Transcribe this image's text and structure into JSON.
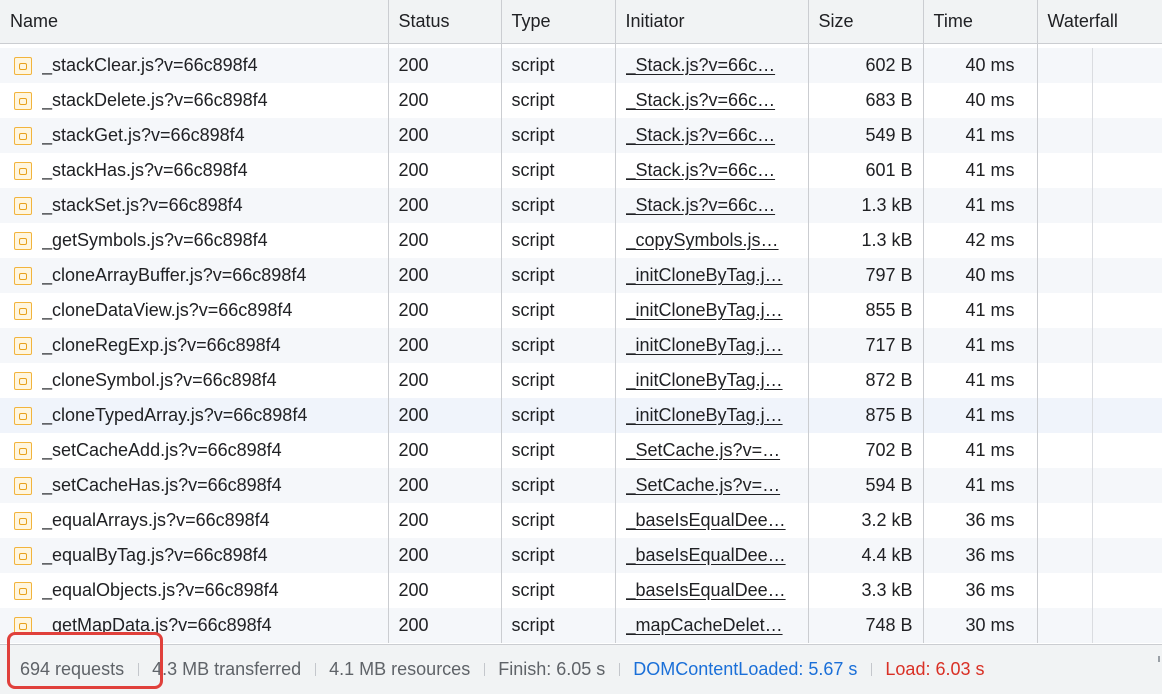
{
  "headers": {
    "name": "Name",
    "status": "Status",
    "type": "Type",
    "initiator": "Initiator",
    "size": "Size",
    "time": "Time",
    "waterfall": "Waterfall"
  },
  "rows": [
    {
      "name": "_stackClear.js?v=66c898f4",
      "status": "200",
      "type": "script",
      "initiator": "_Stack.js?v=66c…",
      "size": "602 B",
      "time": "40 ms"
    },
    {
      "name": "_stackDelete.js?v=66c898f4",
      "status": "200",
      "type": "script",
      "initiator": "_Stack.js?v=66c…",
      "size": "683 B",
      "time": "40 ms"
    },
    {
      "name": "_stackGet.js?v=66c898f4",
      "status": "200",
      "type": "script",
      "initiator": "_Stack.js?v=66c…",
      "size": "549 B",
      "time": "41 ms"
    },
    {
      "name": "_stackHas.js?v=66c898f4",
      "status": "200",
      "type": "script",
      "initiator": "_Stack.js?v=66c…",
      "size": "601 B",
      "time": "41 ms"
    },
    {
      "name": "_stackSet.js?v=66c898f4",
      "status": "200",
      "type": "script",
      "initiator": "_Stack.js?v=66c…",
      "size": "1.3 kB",
      "time": "41 ms"
    },
    {
      "name": "_getSymbols.js?v=66c898f4",
      "status": "200",
      "type": "script",
      "initiator": "_copySymbols.js…",
      "size": "1.3 kB",
      "time": "42 ms"
    },
    {
      "name": "_cloneArrayBuffer.js?v=66c898f4",
      "status": "200",
      "type": "script",
      "initiator": "_initCloneByTag.j…",
      "size": "797 B",
      "time": "40 ms"
    },
    {
      "name": "_cloneDataView.js?v=66c898f4",
      "status": "200",
      "type": "script",
      "initiator": "_initCloneByTag.j…",
      "size": "855 B",
      "time": "41 ms"
    },
    {
      "name": "_cloneRegExp.js?v=66c898f4",
      "status": "200",
      "type": "script",
      "initiator": "_initCloneByTag.j…",
      "size": "717 B",
      "time": "41 ms"
    },
    {
      "name": "_cloneSymbol.js?v=66c898f4",
      "status": "200",
      "type": "script",
      "initiator": "_initCloneByTag.j…",
      "size": "872 B",
      "time": "41 ms"
    },
    {
      "name": "_cloneTypedArray.js?v=66c898f4",
      "status": "200",
      "type": "script",
      "initiator": "_initCloneByTag.j…",
      "size": "875 B",
      "time": "41 ms"
    },
    {
      "name": "_setCacheAdd.js?v=66c898f4",
      "status": "200",
      "type": "script",
      "initiator": "_SetCache.js?v=…",
      "size": "702 B",
      "time": "41 ms"
    },
    {
      "name": "_setCacheHas.js?v=66c898f4",
      "status": "200",
      "type": "script",
      "initiator": "_SetCache.js?v=…",
      "size": "594 B",
      "time": "41 ms"
    },
    {
      "name": "_equalArrays.js?v=66c898f4",
      "status": "200",
      "type": "script",
      "initiator": "_baseIsEqualDee…",
      "size": "3.2 kB",
      "time": "36 ms"
    },
    {
      "name": "_equalByTag.js?v=66c898f4",
      "status": "200",
      "type": "script",
      "initiator": "_baseIsEqualDee…",
      "size": "4.4 kB",
      "time": "36 ms"
    },
    {
      "name": "_equalObjects.js?v=66c898f4",
      "status": "200",
      "type": "script",
      "initiator": "_baseIsEqualDee…",
      "size": "3.3 kB",
      "time": "36 ms"
    },
    {
      "name": "_getMapData.js?v=66c898f4",
      "status": "200",
      "type": "script",
      "initiator": "_mapCacheDelet…",
      "size": "748 B",
      "time": "30 ms"
    }
  ],
  "status_bar": {
    "requests": "694 requests",
    "transferred": "4.3 MB transferred",
    "resources": "4.1 MB resources",
    "finish": "Finish: 6.05 s",
    "dom_content_loaded": "DOMContentLoaded: 5.67 s",
    "load": "Load: 6.03 s"
  },
  "icons": {
    "file": "script-file-icon"
  },
  "colors": {
    "dom_content_loaded": "#1a6fd8",
    "load": "#d93025",
    "highlight": "#e0403b",
    "script_icon": "#f2b43c"
  }
}
